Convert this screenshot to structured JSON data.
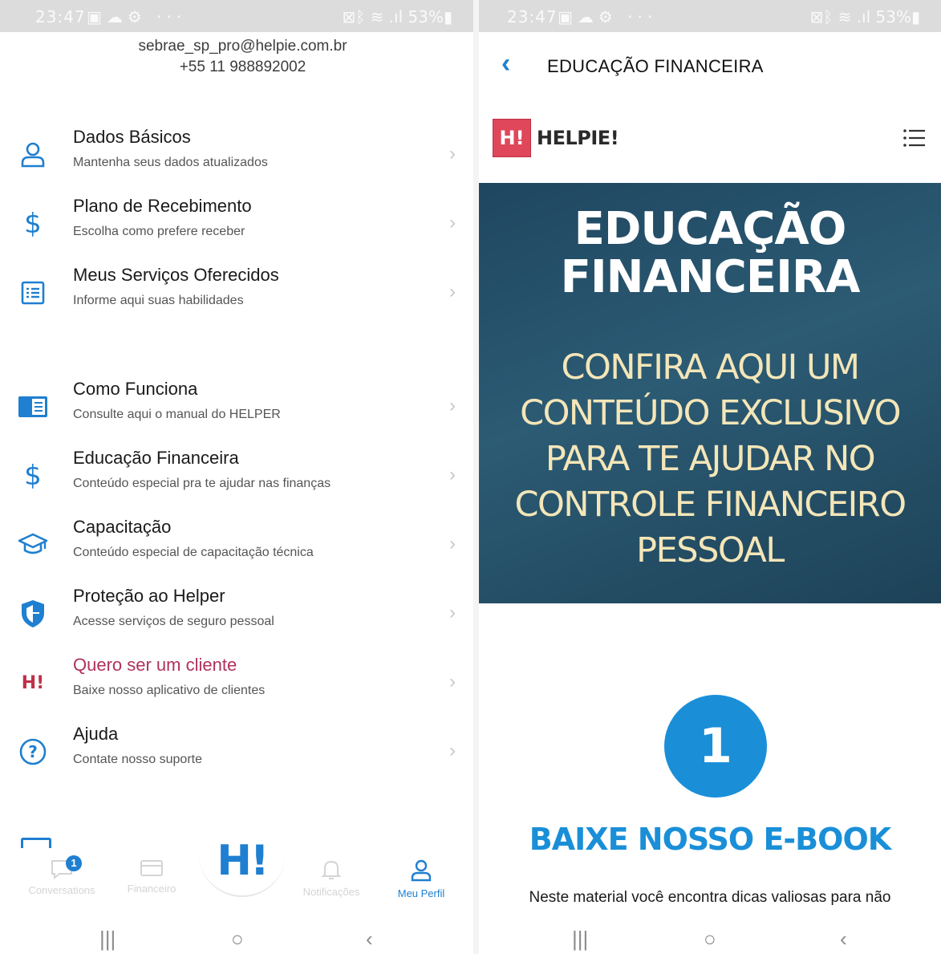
{
  "status_bar": {
    "time": "23:47",
    "battery": "53%"
  },
  "left": {
    "contact": {
      "email": "sebrae_sp_pro@helpie.com.br",
      "phone": "+55 11 988892002"
    },
    "menu": [
      {
        "title": "Dados Básicos",
        "subtitle": "Mantenha seus dados atualizados",
        "icon": "user-icon"
      },
      {
        "title": "Plano de Recebimento",
        "subtitle": "Escolha como prefere receber",
        "icon": "dollar-icon"
      },
      {
        "title": "Meus Serviços Oferecidos",
        "subtitle": "Informe aqui suas habilidades",
        "icon": "list-icon"
      },
      {
        "title": "Como Funciona",
        "subtitle": "Consulte aqui o manual do HELPER",
        "icon": "manual-icon"
      },
      {
        "title": "Educação Financeira",
        "subtitle": "Conteúdo especial pra te ajudar nas finanças",
        "icon": "dollar-icon"
      },
      {
        "title": "Capacitação",
        "subtitle": "Conteúdo especial de capacitação técnica",
        "icon": "graduation-cap-icon"
      },
      {
        "title": "Proteção ao Helper",
        "subtitle": "Acesse serviços de seguro pessoal",
        "icon": "shield-icon"
      },
      {
        "title": "Quero ser um cliente",
        "subtitle": "Baixe nosso aplicativo de clientes",
        "icon": "helpie-logo-icon"
      },
      {
        "title": "Ajuda",
        "subtitle": "Contate nosso suporte",
        "icon": "help-circle-icon"
      }
    ],
    "bottom_nav": {
      "chat_label": "Conversations",
      "chat_badge": "1",
      "wallet_label": "Financeiro",
      "center_logo": "H!",
      "notifications_label": "Notificações",
      "profile_label": "Meu Perfil"
    }
  },
  "right": {
    "title": "EDUCAÇÃO FINANCEIRA",
    "brand": {
      "logo": "H!",
      "name": "HELPIE!"
    },
    "hero": {
      "title_line1": "EDUCAÇÃO",
      "title_line2": "FINANCEIRA",
      "sub_line1": "CONFIRA AQUI UM",
      "sub_line2": "CONTEÚDO EXCLUSIVO",
      "sub_line3": "PARA TE AJUDAR NO",
      "sub_line4": "CONTROLE FINANCEIRO",
      "sub_line5": "PESSOAL"
    },
    "step_number": "1",
    "step_heading": "BAIXE NOSSO E-BOOK",
    "body_text": "Neste material você encontra dicas valiosas para não"
  },
  "colors": {
    "accent": "#1f7fd0",
    "brand_red": "#e0475a",
    "hero_bg": "#234d66",
    "hero_sub": "#f4e6b8",
    "client_text": "#b0325a"
  }
}
